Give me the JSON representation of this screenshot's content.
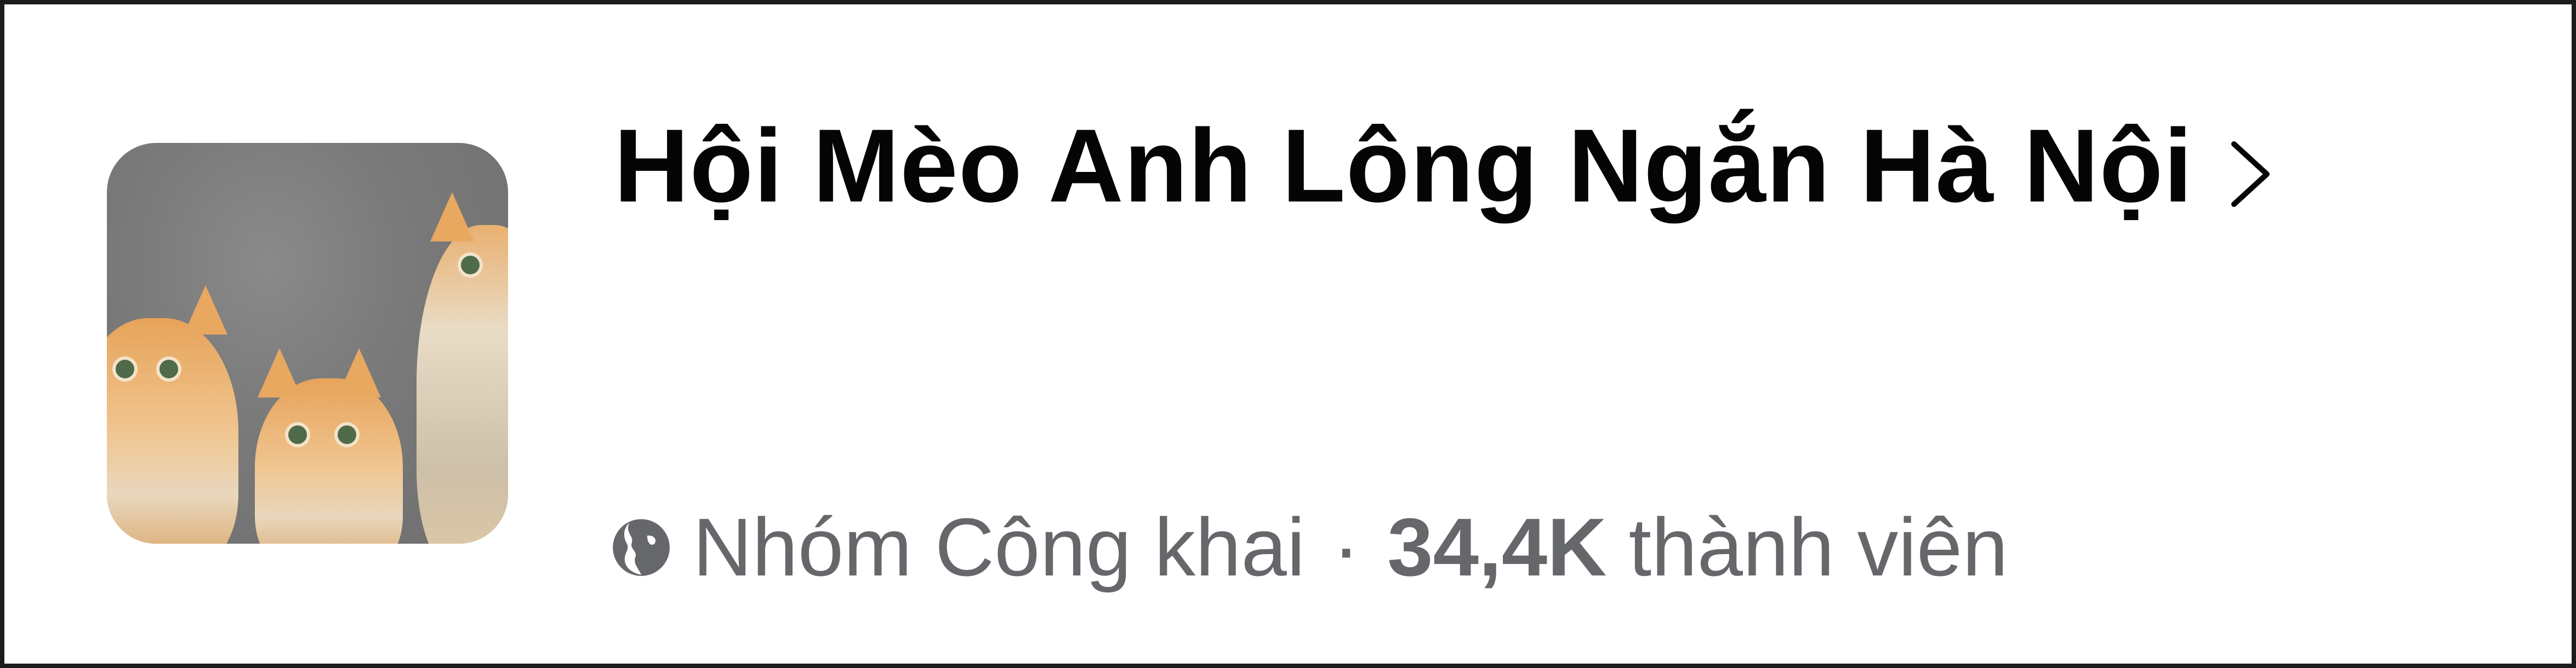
{
  "group": {
    "name": "Hội Mèo Anh Lông Ngắn Hà Nội",
    "privacy": "Nhóm Công khai",
    "separator": "·",
    "member_count": "34,4K",
    "member_label": "thành viên",
    "privacy_icon": "globe-icon",
    "nav_icon": "chevron-right-icon"
  },
  "colors": {
    "title": "#050505",
    "meta": "#65676b",
    "frame": "#1c1c1c"
  }
}
